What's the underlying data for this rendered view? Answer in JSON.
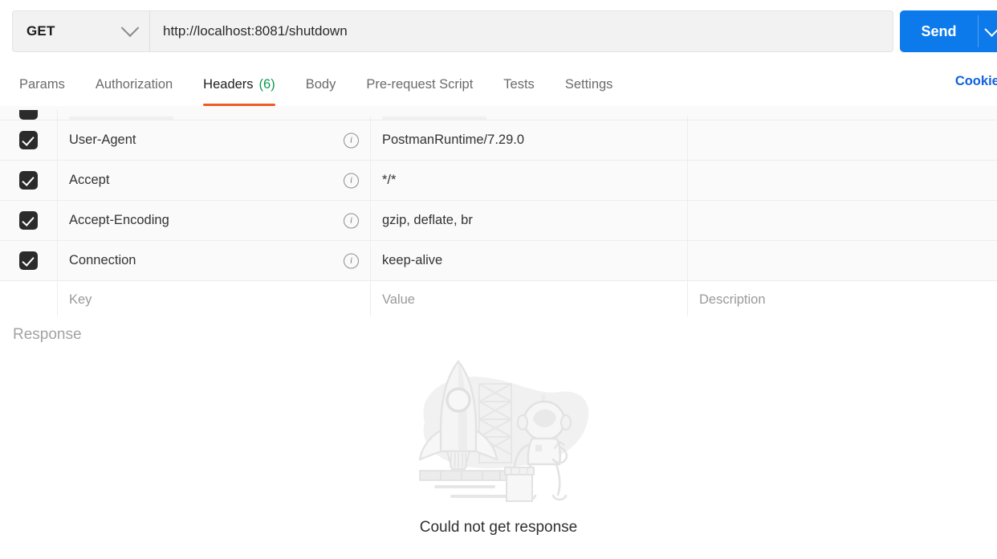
{
  "request": {
    "method": "GET",
    "url": "http://localhost:8081/shutdown",
    "send_label": "Send"
  },
  "tabs": [
    {
      "label": "Params",
      "count": "",
      "active": false
    },
    {
      "label": "Authorization",
      "count": "",
      "active": false
    },
    {
      "label": "Headers",
      "count": "(6)",
      "active": true
    },
    {
      "label": "Body",
      "count": "",
      "active": false
    },
    {
      "label": "Pre-request Script",
      "count": "",
      "active": false
    },
    {
      "label": "Tests",
      "count": "",
      "active": false
    },
    {
      "label": "Settings",
      "count": "",
      "active": false
    }
  ],
  "cookies_label": "Cookies",
  "headers_table": {
    "columns": [
      "Key",
      "Value",
      "Description"
    ],
    "placeholders": {
      "key": "Key",
      "value": "Value",
      "description": "Description"
    },
    "rows": [
      {
        "enabled": true,
        "key": "User-Agent",
        "value": "PostmanRuntime/7.29.0",
        "description": ""
      },
      {
        "enabled": true,
        "key": "Accept",
        "value": "*/*",
        "description": ""
      },
      {
        "enabled": true,
        "key": "Accept-Encoding",
        "value": "gzip, deflate, br",
        "description": ""
      },
      {
        "enabled": true,
        "key": "Connection",
        "value": "keep-alive",
        "description": ""
      }
    ]
  },
  "response": {
    "title": "Response",
    "empty_message": "Could not get response",
    "illustration": "rocket-astronaut-illustration"
  },
  "colors": {
    "accent_orange": "#ef5b25",
    "send_blue": "#0d7aeb",
    "link_blue": "#1161e0",
    "count_green": "#0c9a53",
    "checkbox_dark": "#2b2b2b"
  }
}
